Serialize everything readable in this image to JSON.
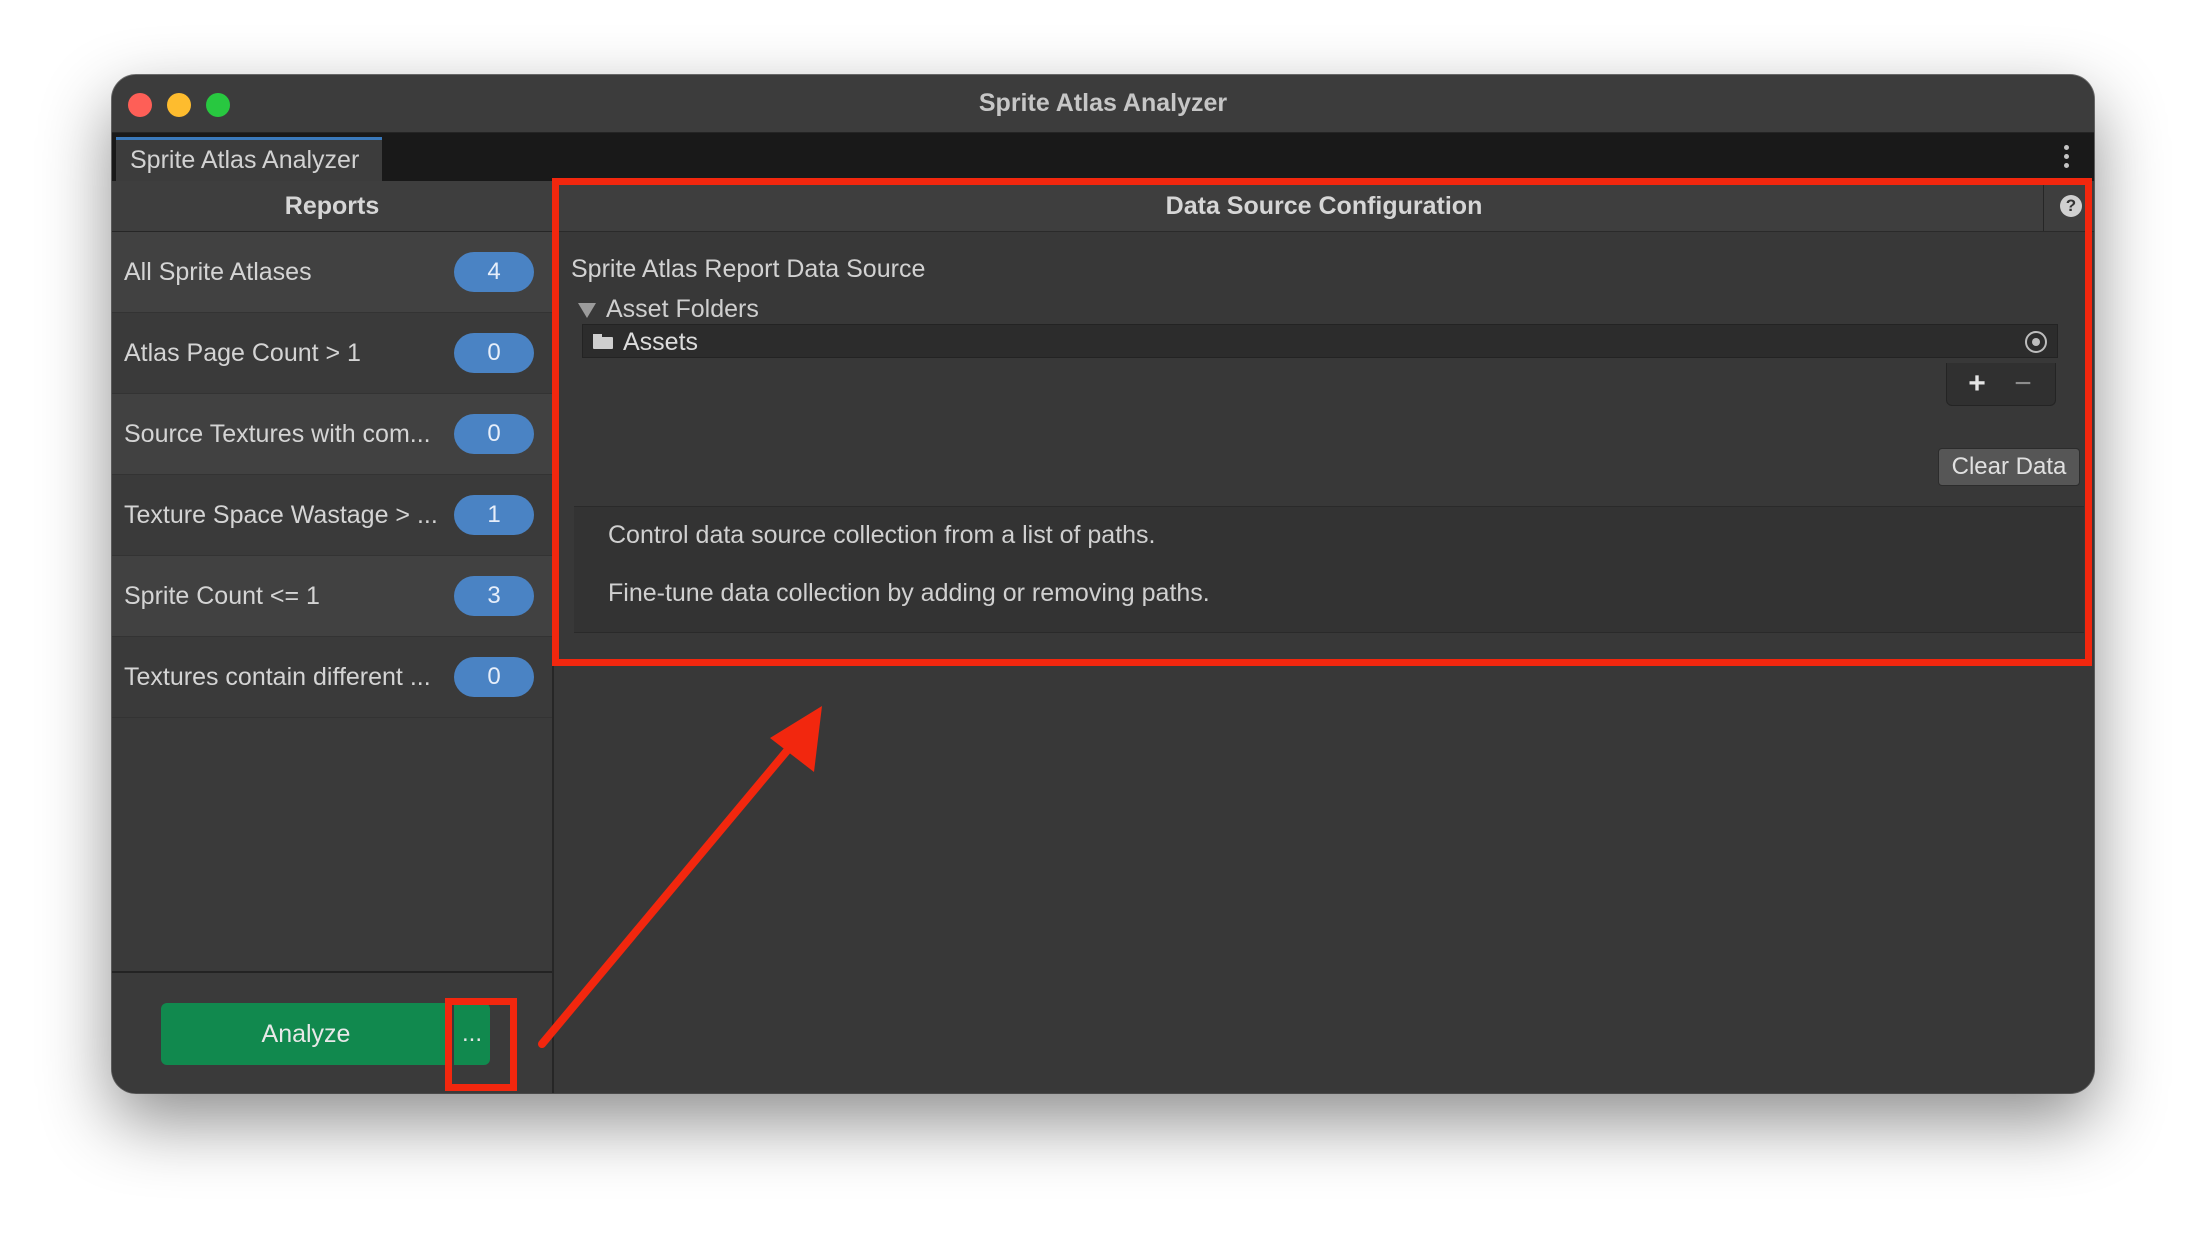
{
  "window": {
    "title": "Sprite Atlas Analyzer"
  },
  "tab": {
    "label": "Sprite Atlas Analyzer"
  },
  "reports": {
    "header": "Reports",
    "items": [
      {
        "label": "All Sprite Atlases",
        "count": "4"
      },
      {
        "label": "Atlas Page Count > 1",
        "count": "0"
      },
      {
        "label": "Source Textures with com...",
        "count": "0"
      },
      {
        "label": "Texture Space Wastage > ...",
        "count": "1"
      },
      {
        "label": "Sprite Count <= 1",
        "count": "3"
      },
      {
        "label": "Textures contain different ...",
        "count": "0"
      }
    ]
  },
  "footer": {
    "analyze_label": "Analyze",
    "more_label": "..."
  },
  "config": {
    "header": "Data Source Configuration",
    "help_glyph": "?",
    "source_title": "Sprite Atlas Report Data Source",
    "folders_label": "Asset Folders",
    "folders": [
      {
        "label": "Assets"
      }
    ],
    "add_glyph": "+",
    "remove_glyph": "−",
    "clear_label": "Clear Data",
    "info": [
      "Control data source collection from a list of paths.",
      "Fine-tune data collection by adding or removing paths."
    ]
  },
  "colors": {
    "highlight": "#f2270e",
    "badge": "#4a83c4",
    "analyze": "#11894e",
    "tab_accent": "#3a79bb"
  }
}
